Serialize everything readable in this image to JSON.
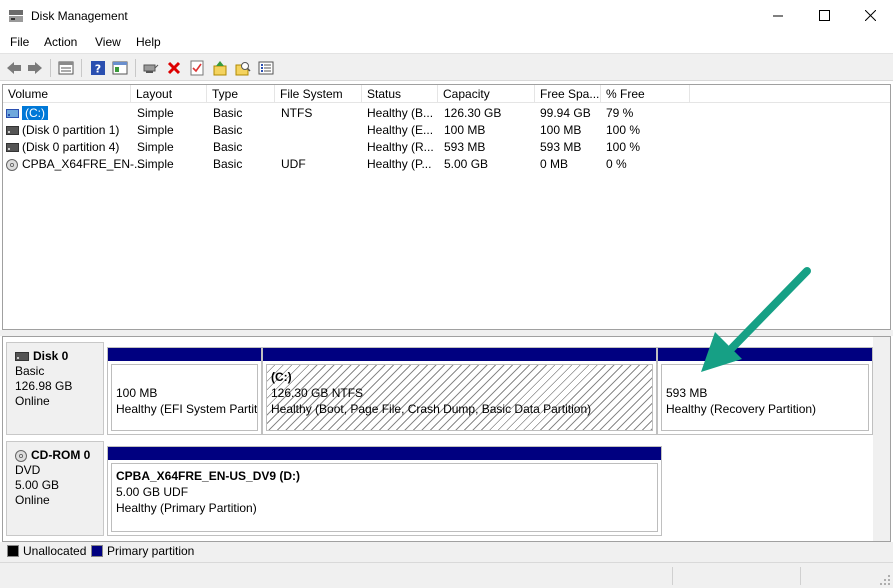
{
  "window": {
    "title": "Disk Management"
  },
  "menu": [
    "File",
    "Action",
    "View",
    "Help"
  ],
  "toolbar": [
    {
      "icon": "back-arrow-icon"
    },
    {
      "icon": "forward-arrow-icon"
    },
    {
      "icon": "disk-list-view-icon"
    },
    {
      "icon": "help-icon"
    },
    {
      "icon": "console-tree-icon"
    },
    {
      "icon": "connect-drive-icon"
    },
    {
      "icon": "delete-icon"
    },
    {
      "icon": "check-properties-icon"
    },
    {
      "icon": "import-icon"
    },
    {
      "icon": "search-folder-icon"
    },
    {
      "icon": "settings-list-icon"
    }
  ],
  "volume_list": {
    "columns": [
      "Volume",
      "Layout",
      "Type",
      "File System",
      "Status",
      "Capacity",
      "Free Spa...",
      "% Free"
    ],
    "rows": [
      {
        "volume": "(C:)",
        "layout": "Simple",
        "type": "Basic",
        "fs": "NTFS",
        "status": "Healthy (B...",
        "capacity": "126.30 GB",
        "free": "99.94 GB",
        "pct": "79 %",
        "icon": "drive-icon",
        "selected": true
      },
      {
        "volume": "(Disk 0 partition 1)",
        "layout": "Simple",
        "type": "Basic",
        "fs": "",
        "status": "Healthy (E...",
        "capacity": "100 MB",
        "free": "100 MB",
        "pct": "100 %",
        "icon": "drive-icon",
        "selected": false
      },
      {
        "volume": "(Disk 0 partition 4)",
        "layout": "Simple",
        "type": "Basic",
        "fs": "",
        "status": "Healthy (R...",
        "capacity": "593 MB",
        "free": "593 MB",
        "pct": "100 %",
        "icon": "drive-icon",
        "selected": false
      },
      {
        "volume": "CPBA_X64FRE_EN-...",
        "layout": "Simple",
        "type": "Basic",
        "fs": "UDF",
        "status": "Healthy (P...",
        "capacity": "5.00 GB",
        "free": "0 MB",
        "pct": "0 %",
        "icon": "cd-drive-icon",
        "selected": false
      }
    ]
  },
  "disks": {
    "disk0": {
      "name": "Disk 0",
      "type": "Basic",
      "size": "126.98 GB",
      "state": "Online",
      "partitions": [
        {
          "title": "",
          "size": "100 MB",
          "status": "Healthy (EFI System Partiti"
        },
        {
          "title": "(C:)",
          "size": "126.30 GB NTFS",
          "status": "Healthy (Boot, Page File, Crash Dump, Basic Data Partition)"
        },
        {
          "title": "",
          "size": "593 MB",
          "status": "Healthy (Recovery Partition)"
        }
      ]
    },
    "cdrom0": {
      "name": "CD-ROM 0",
      "type": "DVD",
      "size": "5.00 GB",
      "state": "Online",
      "partitions": [
        {
          "title": "CPBA_X64FRE_EN-US_DV9  (D:)",
          "size": "5.00 GB UDF",
          "status": "Healthy (Primary Partition)"
        }
      ]
    }
  },
  "legend": [
    {
      "label": "Unallocated",
      "color": "#000000"
    },
    {
      "label": "Primary partition",
      "color": "#000080"
    }
  ],
  "colors": {
    "selection": "#0078d7",
    "partition_bar": "#000080",
    "annotation_arrow": "#16a085"
  }
}
